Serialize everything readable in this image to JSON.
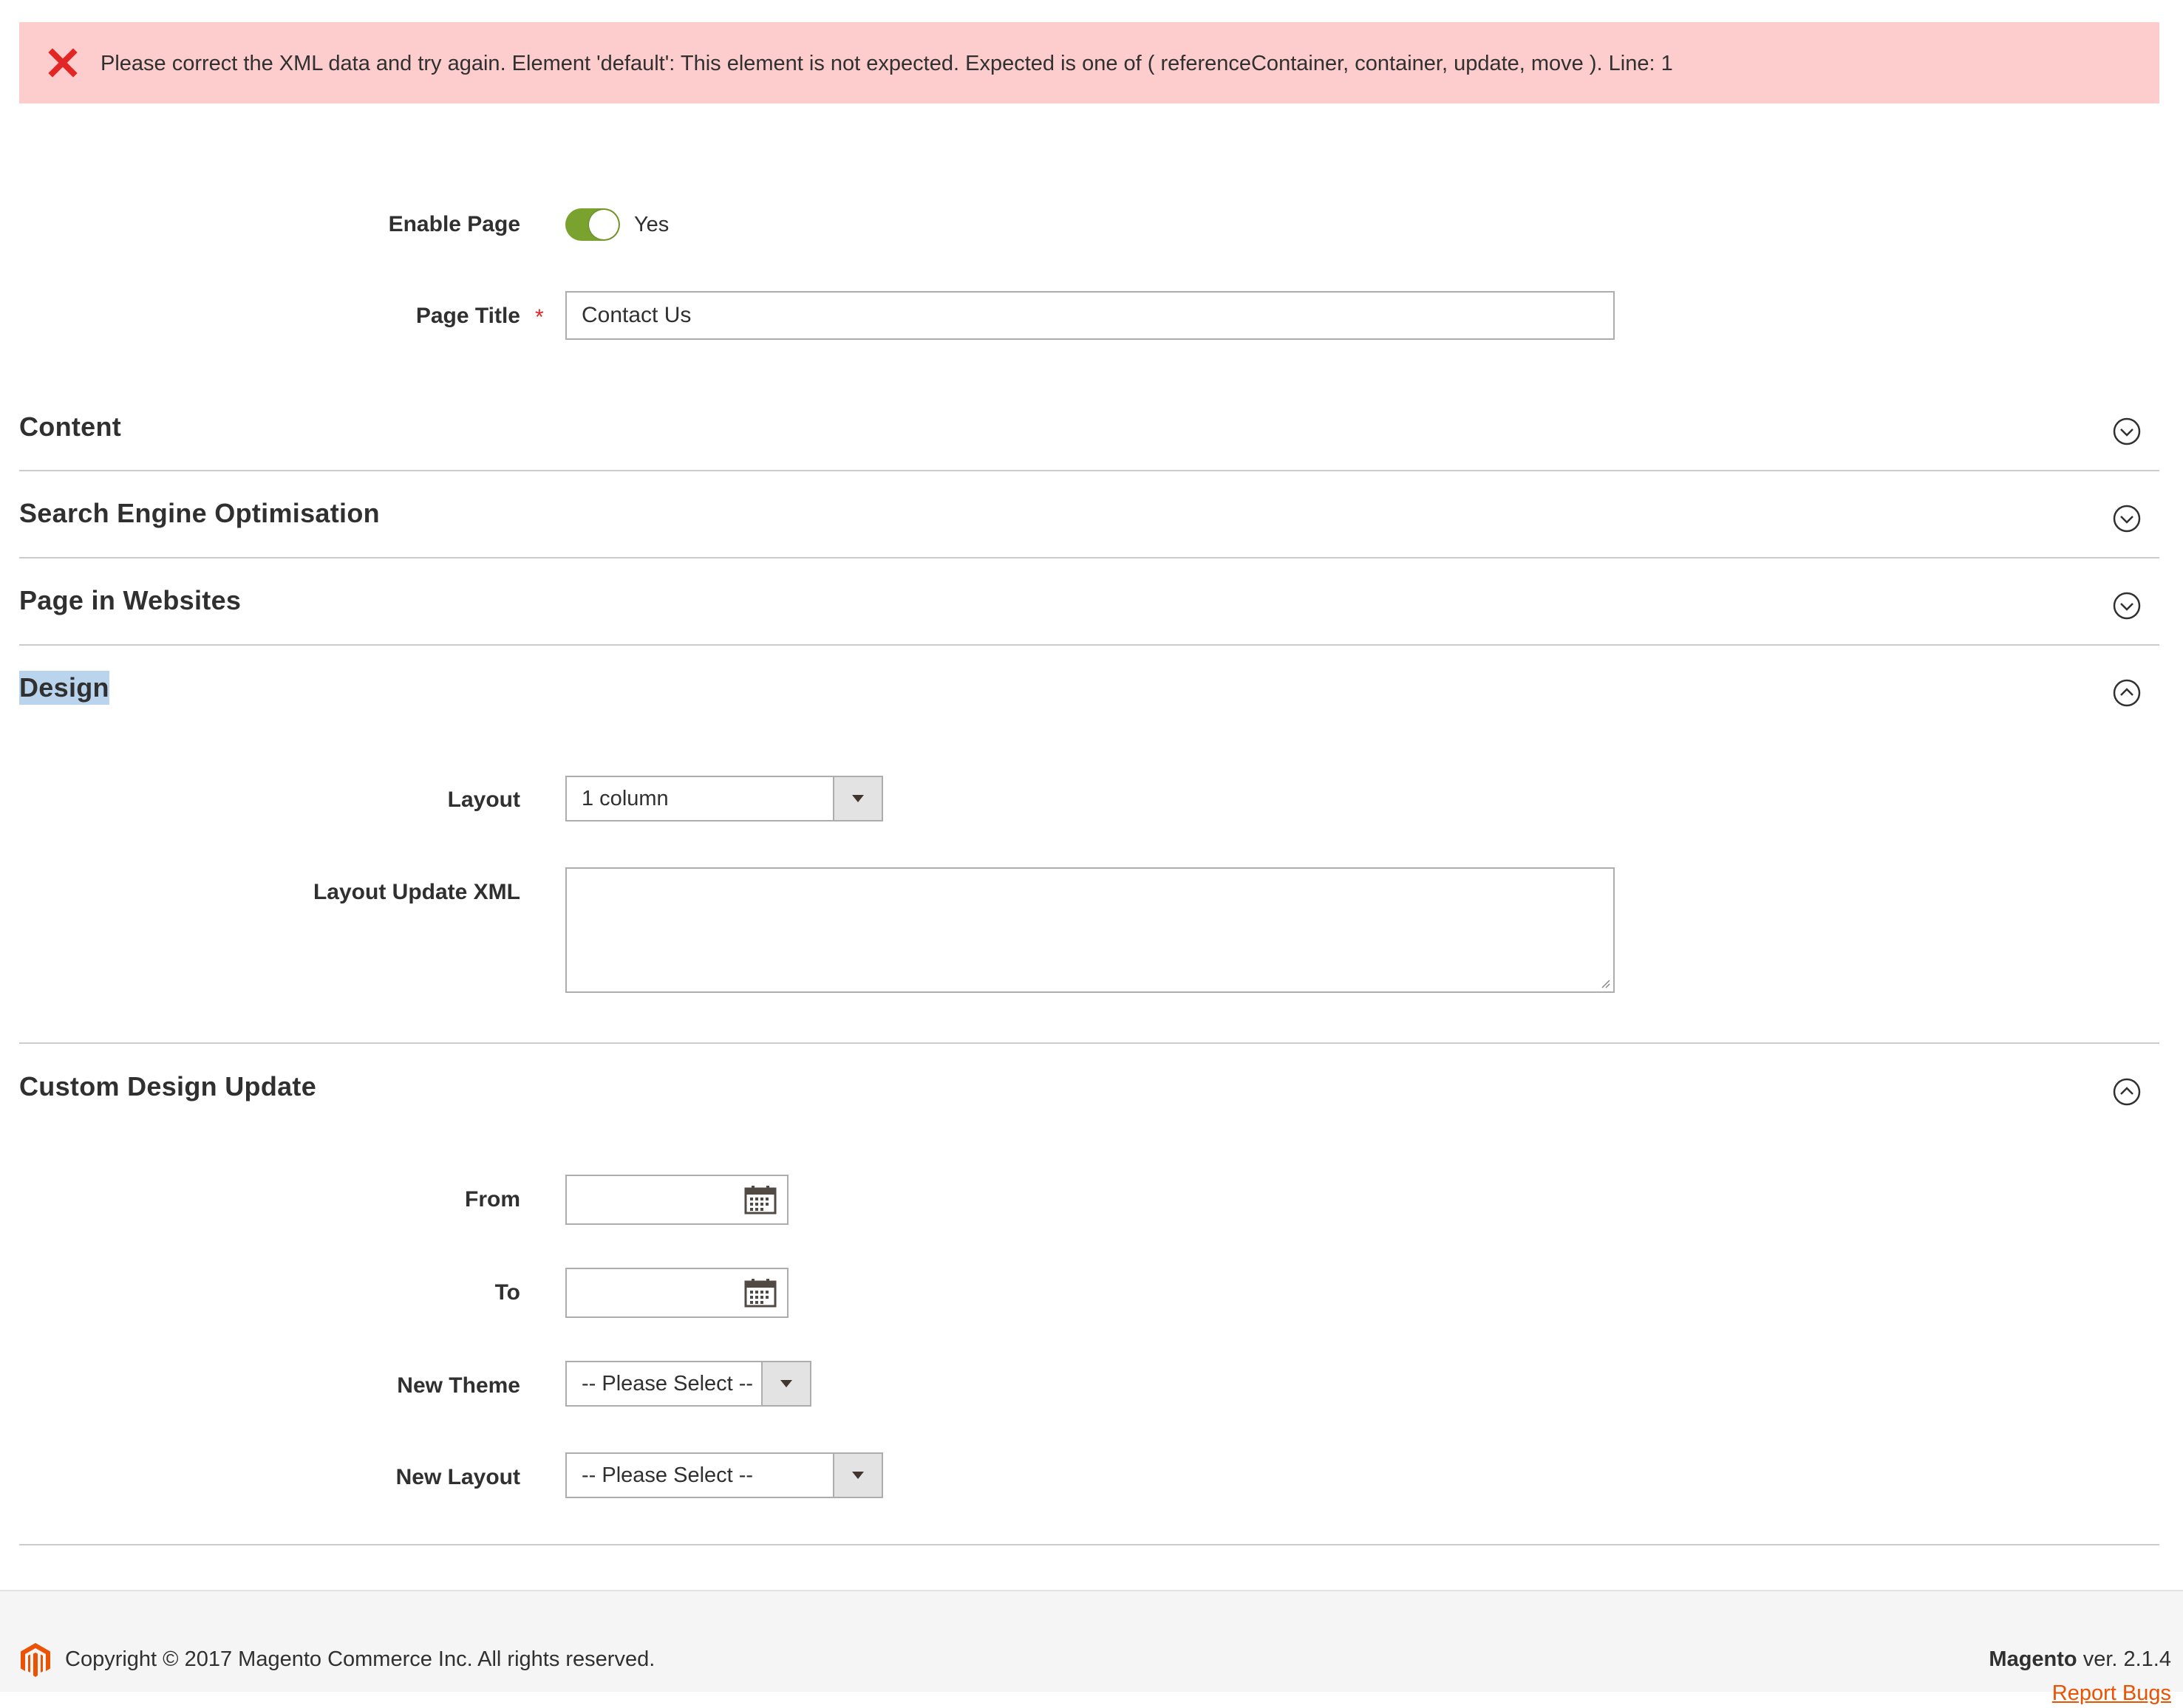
{
  "message": {
    "type": "error",
    "text": "Please correct the XML data and try again. Element 'default': This element is not expected. Expected is one of ( referenceContainer, container, update, move ). Line: 1",
    "icon": "error-x-icon"
  },
  "form": {
    "enable_page": {
      "label": "Enable Page",
      "value": "Yes",
      "checked": true
    },
    "page_title": {
      "label": "Page Title",
      "required_mark": "*",
      "value": "Contact Us"
    }
  },
  "sections": {
    "content": {
      "title": "Content",
      "state": "collapsed"
    },
    "seo": {
      "title": "Search Engine Optimisation",
      "state": "collapsed"
    },
    "websites": {
      "title": "Page in Websites",
      "state": "collapsed"
    },
    "design": {
      "title": "Design",
      "state": "expanded",
      "layout": {
        "label": "Layout",
        "value": "1 column"
      },
      "layout_update_xml": {
        "label": "Layout Update XML",
        "value": ""
      }
    },
    "custom_design": {
      "title": "Custom Design Update",
      "state": "expanded",
      "from": {
        "label": "From",
        "value": ""
      },
      "to": {
        "label": "To",
        "value": ""
      },
      "new_theme": {
        "label": "New Theme",
        "value": "-- Please Select --"
      },
      "new_layout": {
        "label": "New Layout",
        "value": "-- Please Select --"
      }
    }
  },
  "footer": {
    "copyright": "Copyright © 2017 Magento Commerce Inc. All rights reserved.",
    "brand": "Magento",
    "version": " ver. 2.1.4",
    "report_bugs": "Report Bugs"
  },
  "colors": {
    "error_bg": "#fdcccc",
    "error_icon": "#e22626",
    "toggle_on": "#79a22e",
    "accent": "#eb5202"
  }
}
